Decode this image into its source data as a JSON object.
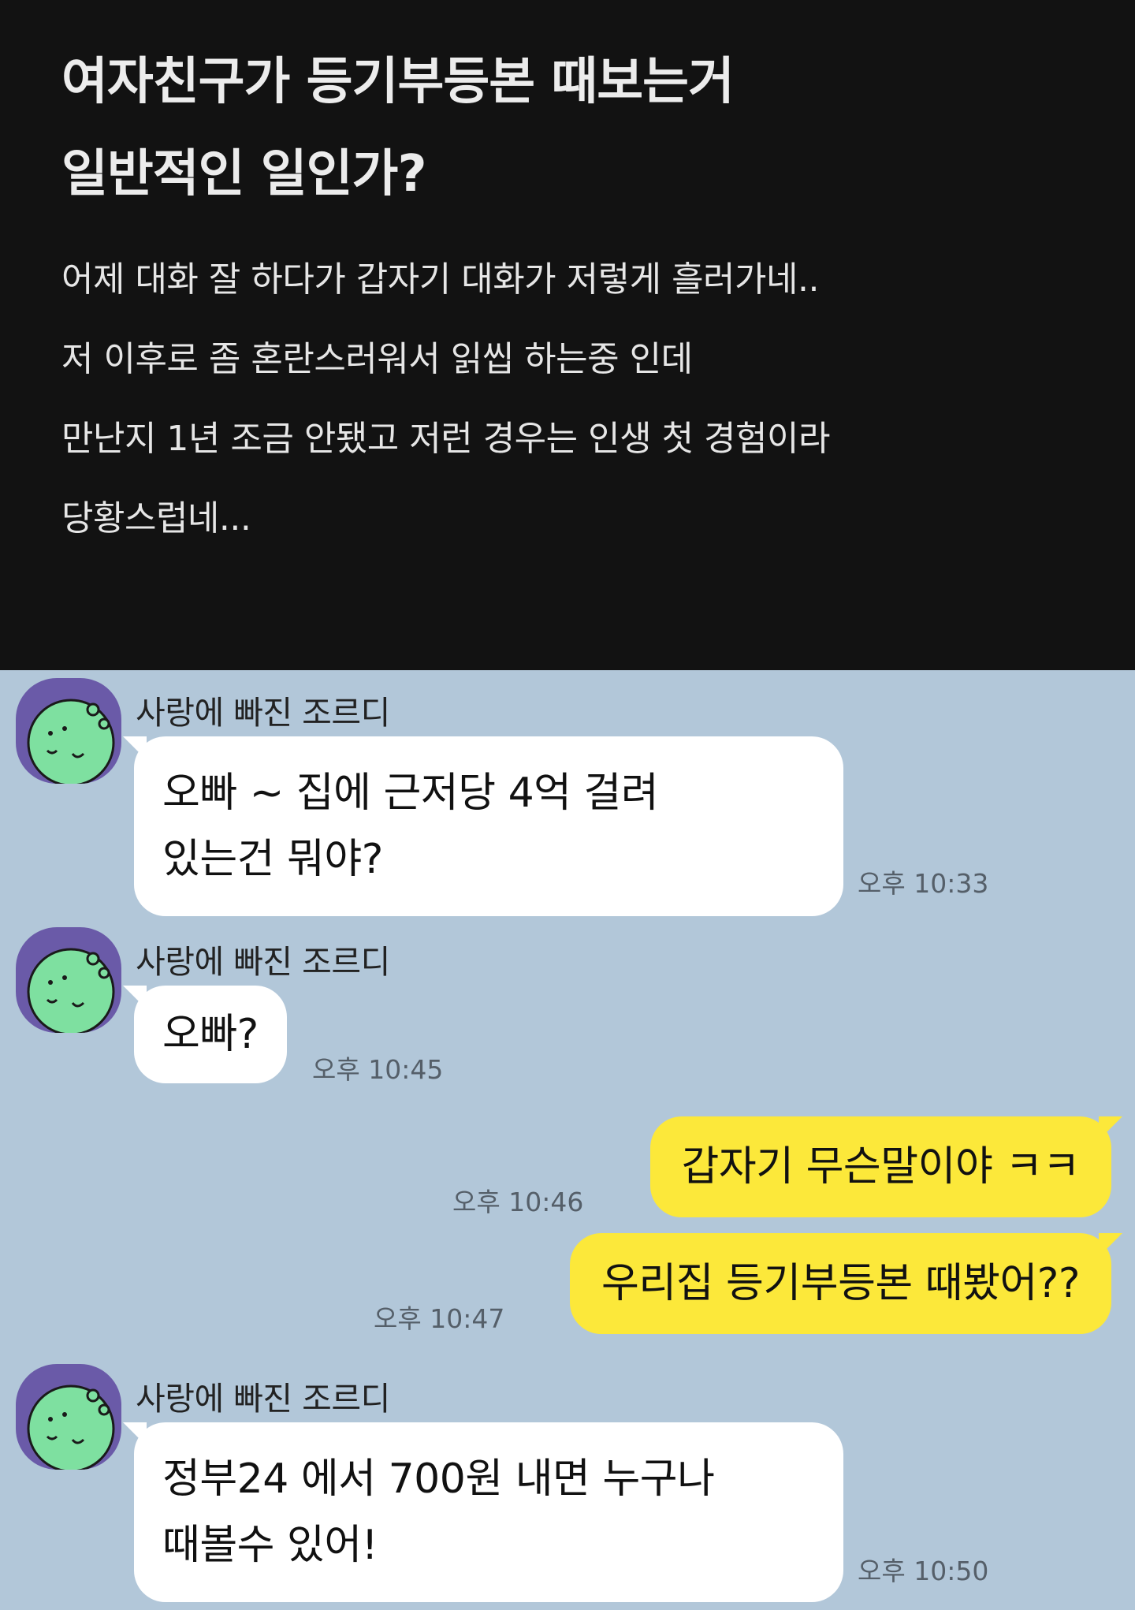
{
  "post": {
    "title_line1": "여자친구가 등기부등본 때보는거",
    "title_line2": "일반적인 일인가?",
    "body_lines": [
      "어제 대화 잘 하다가 갑자기 대화가 저렇게 흘러가네..",
      "저 이후로 좀 혼란스러워서 읽씹 하는중 인데",
      "만난지 1년 조금 안됐고 저런 경우는 인생 첫 경험이라",
      "당황스럽네..."
    ]
  },
  "chat": {
    "sender_name": "사랑에 빠진 조르디",
    "messages": [
      {
        "direction": "in",
        "lines": [
          "오빠 ~  집에 근저당 4억 걸려",
          "있는건 뭐야?"
        ],
        "time": "오후 10:33"
      },
      {
        "direction": "in",
        "lines": [
          "오빠?"
        ],
        "time": "오후 10:45"
      },
      {
        "direction": "out",
        "lines": [
          "갑자기 무슨말이야 ㅋㅋ"
        ],
        "time": "오후 10:46"
      },
      {
        "direction": "out",
        "lines": [
          "우리집 등기부등본 때봤어??"
        ],
        "time": "오후 10:47"
      },
      {
        "direction": "in",
        "lines": [
          "정부24 에서 700원 내면 누구나",
          "때볼수 있어!"
        ],
        "time": "오후 10:50"
      }
    ]
  },
  "colors": {
    "post_background": "#121212",
    "chat_background": "#b2c7d9",
    "incoming_bubble": "#ffffff",
    "outgoing_bubble": "#fce83a",
    "avatar_background": "#6a5aa8",
    "avatar_character": "#7ee0a0"
  },
  "icons": {
    "avatar": "jordy-dinosaur-avatar"
  }
}
